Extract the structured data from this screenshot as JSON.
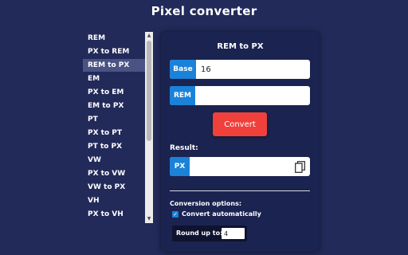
{
  "app": {
    "title": "Pixel converter"
  },
  "sidebar": {
    "items": [
      {
        "label": "REM"
      },
      {
        "label": "PX to REM"
      },
      {
        "label": "REM to PX",
        "active": true
      },
      {
        "label": "EM"
      },
      {
        "label": "PX to EM"
      },
      {
        "label": "EM to PX"
      },
      {
        "label": "PT"
      },
      {
        "label": "PX to PT"
      },
      {
        "label": "PT to PX"
      },
      {
        "label": "VW"
      },
      {
        "label": "PX to VW"
      },
      {
        "label": "VW to PX"
      },
      {
        "label": "VH"
      },
      {
        "label": "PX to VH"
      }
    ]
  },
  "panel": {
    "title": "REM to PX",
    "base": {
      "tag": "Base",
      "value": "16"
    },
    "rem": {
      "tag": "REM",
      "value": ""
    },
    "convert_label": "Convert",
    "result": {
      "label": "Result:",
      "tag": "PX",
      "value": "",
      "copy_icon": "copy-icon"
    },
    "options": {
      "label": "Conversion options:",
      "auto_label": "Convert automatically",
      "auto_checked": true,
      "round_label": "Round up to:",
      "round_value": "4"
    }
  },
  "colors": {
    "background": "#222a5a",
    "panel": "#1b2350",
    "accent": "#1a82d8",
    "button": "#f0403c",
    "active_item": "#4a5384"
  }
}
